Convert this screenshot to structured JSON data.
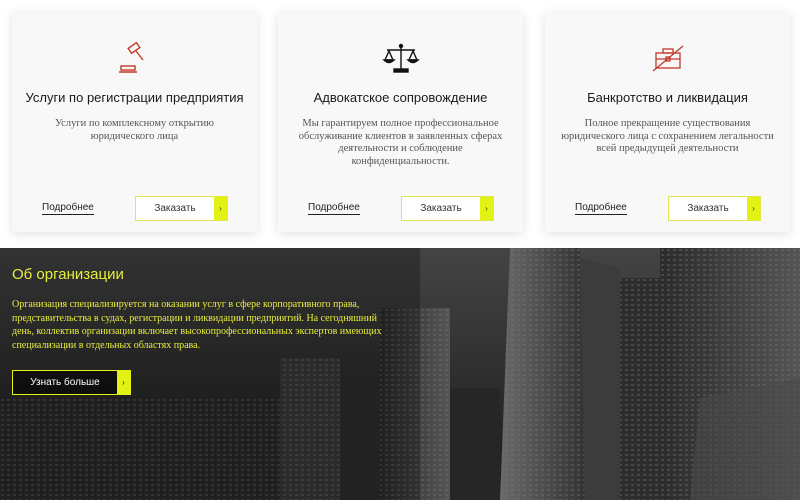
{
  "colors": {
    "accent": "#e2f212",
    "icon_red": "#c0392b",
    "text_dark": "#1a1a1a"
  },
  "services": [
    {
      "icon": "gavel-icon",
      "title": "Услуги по регистрации предприятия",
      "description": "Услуги по комплексному открытию юридического лица",
      "more": "Подробнее",
      "order": "Заказать",
      "arrow": "›"
    },
    {
      "icon": "scales-icon",
      "title": "Адвокатское сопровождение",
      "description": "Мы гарантируем полное профессиональное обслуживание клиентов в заявленных сферах деятельности и соблюдение конфиденциальности.",
      "more": "Подробнее",
      "order": "Заказать",
      "arrow": "›"
    },
    {
      "icon": "crossed-briefcase-icon",
      "title": "Банкротство и ликвидация",
      "description": "Полное прекращение существования юридического лица с сохранением легальности всей предыдущей деятельности",
      "more": "Подробнее",
      "order": "Заказать",
      "arrow": "›"
    }
  ],
  "about": {
    "title": "Об организации",
    "text": "Организация специализируется на оказании услуг в сфере корпоративного права, представительства в судах, регистрации и ликвидации предприятий. На сегодняшний день, коллектив организации включает высокопрофессиональных экспертов имеющих специализации в отдельных областях права.",
    "button": "Узнать больше",
    "arrow": "›"
  }
}
